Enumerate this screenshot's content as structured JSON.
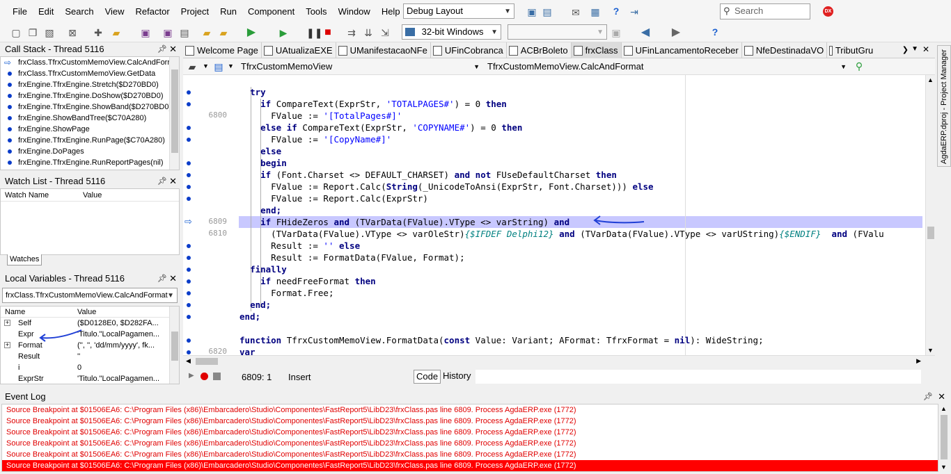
{
  "menu": [
    "File",
    "Edit",
    "Search",
    "View",
    "Refactor",
    "Project",
    "Run",
    "Component",
    "Tools",
    "Window",
    "Help"
  ],
  "layout_combo": "Debug Layout",
  "platform_combo": "32-bit Windows",
  "search_placeholder": "Search",
  "dx_badge": "DX",
  "call_stack": {
    "title": "Call Stack - Thread 5116",
    "rows": [
      "frxClass.TfrxCustomMemoView.CalcAndForr",
      "frxClass.TfrxCustomMemoView.GetData",
      "frxEngine.TfrxEngine.Stretch($D270BD0)",
      "frxEngine.TfrxEngine.DoShow($D270BD0)",
      "frxEngine.TfrxEngine.ShowBand($D270BD0)",
      "frxEngine.ShowBandTree($C70A280)",
      "frxEngine.ShowPage",
      "frxEngine.TfrxEngine.RunPage($C70A280)",
      "frxEngine.DoPages",
      "frxEngine.TfrxEngine.RunReportPages(nil)"
    ]
  },
  "watch_list": {
    "title": "Watch List - Thread 5116",
    "col_name": "Watch Name",
    "col_value": "Value",
    "tab": "Watches"
  },
  "local_vars": {
    "title": "Local Variables - Thread 5116",
    "combo": "frxClass.TfrxCustomMemoView.CalcAndFormat",
    "col_name": "Name",
    "col_value": "Value",
    "rows": [
      {
        "name": "Self",
        "value": "($D0128E0, $D282FA..."
      },
      {
        "name": "Expr",
        "value": "'Titulo.\"LocalPagamen..."
      },
      {
        "name": "Format",
        "value": "('', '', 'dd/mm/yyyy', fk..."
      },
      {
        "name": "Result",
        "value": "''"
      },
      {
        "name": "i",
        "value": "0"
      },
      {
        "name": "ExprStr",
        "value": "'Titulo.\"LocalPagamen..."
      }
    ]
  },
  "tabs": [
    "Welcome Page",
    "UAtualizaEXE",
    "UManifestacaoNFe",
    "UFinCobranca",
    "ACBrBoleto",
    "frxClass",
    "UFinLancamentoReceber",
    "NfeDestinadaVO",
    "TributGru"
  ],
  "active_tab": "frxClass",
  "editor": {
    "class_combo": "TfrxCustomMemoView",
    "method_combo": "TfrxCustomMemoView.CalcAndFormat",
    "line_numbers": {
      "l6800": "6800",
      "l6809": "6809",
      "l6810": "6810",
      "l6820": "6820"
    }
  },
  "code": {
    "l1": "try",
    "l2a": "if ",
    "l2b": "CompareText(ExprStr, ",
    "l2c": "'TOTALPAGES#'",
    "l2d": ") = 0 ",
    "l2e": "then",
    "l3a": "FValue := ",
    "l3b": "'[TotalPages#]'",
    "l3c": "",
    "l4a": "else if ",
    "l4b": "CompareText(ExprStr, ",
    "l4c": "'COPYNAME#'",
    "l4d": ") = 0 ",
    "l4e": "then",
    "l5a": "FValue := ",
    "l5b": "'[CopyName#]'",
    "l6": "else",
    "l7": "begin",
    "l8a": "if ",
    "l8b": "(Font.Charset <> DEFAULT_CHARSET) ",
    "l8c": "and not ",
    "l8d": "FUseDefaultCharset ",
    "l8e": "then",
    "l9a": "FValue := Report.Calc(",
    "l9b": "String",
    "l9c": "(_UnicodeToAnsi(ExprStr, Font.Charset))) ",
    "l9d": "else",
    "l10": "FValue := Report.Calc(ExprStr)",
    "l11": "end;",
    "l12a": "if ",
    "l12b": "FHideZeros ",
    "l12c": "and ",
    "l12d": "(TVarData(FValue).VType <> varString) ",
    "l12e": "and",
    "l13a": "(TVarData(FValue).VType <> varOleStr)",
    "l13b": "{$IFDEF Delphi12}",
    "l13c": " and ",
    "l13d": "(TVarData(FValue).VType <> varUString)",
    "l13e": "{$ENDIF}",
    "l13f": "  and ",
    "l13g": "(FValu",
    "l14a": "Result := ",
    "l14b": "''",
    "l14c": " else",
    "l15": "Result := FormatData(FValue, Format);",
    "l16": "finally",
    "l17a": "if ",
    "l17b": "needFreeFormat ",
    "l17c": "then",
    "l18": "Format.Free;",
    "l19": "end;",
    "l20": "end;",
    "l22a": "function ",
    "l22b": "TfrxCustomMemoView.FormatData(",
    "l22c": "const ",
    "l22d": "Value: Variant; AFormat: TfrxFormat = ",
    "l22e": "nil",
    "l22f": "): WideString;",
    "l23": "var"
  },
  "status": {
    "position": "6809:   1",
    "mode": "Insert",
    "tab_code": "Code",
    "tab_history": "History"
  },
  "event_log": {
    "title": "Event Log",
    "rows": [
      "Source Breakpoint at $01506EA6: C:\\Program Files (x86)\\Embarcadero\\Studio\\Componentes\\FastReport5\\LibD23\\frxClass.pas line 6809. Process AgdaERP.exe (1772)",
      "Source Breakpoint at $01506EA6: C:\\Program Files (x86)\\Embarcadero\\Studio\\Componentes\\FastReport5\\LibD23\\frxClass.pas line 6809. Process AgdaERP.exe (1772)",
      "Source Breakpoint at $01506EA6: C:\\Program Files (x86)\\Embarcadero\\Studio\\Componentes\\FastReport5\\LibD23\\frxClass.pas line 6809. Process AgdaERP.exe (1772)",
      "Source Breakpoint at $01506EA6: C:\\Program Files (x86)\\Embarcadero\\Studio\\Componentes\\FastReport5\\LibD23\\frxClass.pas line 6809. Process AgdaERP.exe (1772)",
      "Source Breakpoint at $01506EA6: C:\\Program Files (x86)\\Embarcadero\\Studio\\Componentes\\FastReport5\\LibD23\\frxClass.pas line 6809. Process AgdaERP.exe (1772)",
      "Source Breakpoint at $01506EA6: C:\\Program Files (x86)\\Embarcadero\\Studio\\Componentes\\FastReport5\\LibD23\\frxClass.pas line 6809. Process AgdaERP.exe (1772)"
    ]
  },
  "project_manager_label": "AgdaERP.dproj - Project Manager",
  "colors": {
    "highlight": "#c8c8ff",
    "error": "#e00000",
    "selected_error": "#ff0000",
    "annotation": "#1f3fd6"
  }
}
